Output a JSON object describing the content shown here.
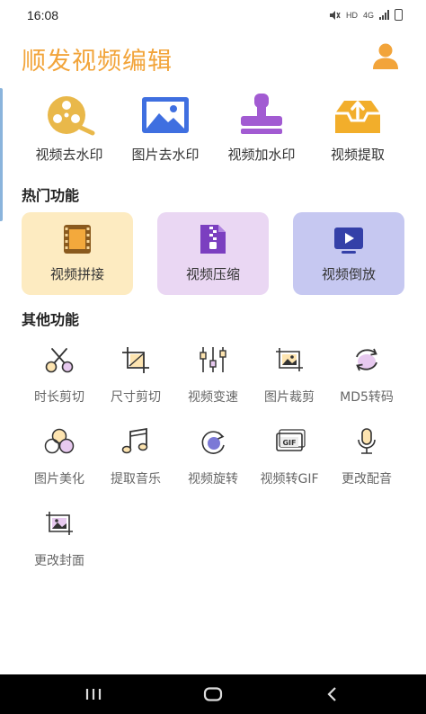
{
  "status_bar": {
    "time": "16:08",
    "hd": "HD",
    "network": "4G"
  },
  "header": {
    "title": "顺发视频编辑",
    "accent_color": "#f2a43a"
  },
  "top_features": [
    {
      "label": "视频去水印",
      "icon": "film-reel-icon"
    },
    {
      "label": "图片去水印",
      "icon": "landscape-image-icon"
    },
    {
      "label": "视频加水印",
      "icon": "stamp-icon"
    },
    {
      "label": "视频提取",
      "icon": "upload-tray-icon"
    }
  ],
  "hot_section": {
    "title": "热门功能",
    "cards": [
      {
        "label": "视频拼接",
        "icon": "film-strip-icon",
        "bg": "#fdebc1"
      },
      {
        "label": "视频压缩",
        "icon": "zip-file-icon",
        "bg": "#ead7f3"
      },
      {
        "label": "视频倒放",
        "icon": "play-icon",
        "bg": "#c6c8f1"
      }
    ]
  },
  "other_section": {
    "title": "其他功能",
    "tools": [
      {
        "label": "时长剪切",
        "icon": "scissors-icon"
      },
      {
        "label": "尺寸剪切",
        "icon": "crop-icon"
      },
      {
        "label": "视频变速",
        "icon": "sliders-icon"
      },
      {
        "label": "图片裁剪",
        "icon": "image-crop-icon"
      },
      {
        "label": "MD5转码",
        "icon": "refresh-icon"
      },
      {
        "label": "图片美化",
        "icon": "circles-icon"
      },
      {
        "label": "提取音乐",
        "icon": "music-note-icon"
      },
      {
        "label": "视频旋转",
        "icon": "rotate-icon"
      },
      {
        "label": "视频转GIF",
        "icon": "gif-icon"
      },
      {
        "label": "更改配音",
        "icon": "microphone-icon"
      },
      {
        "label": "更改封面",
        "icon": "cover-image-icon"
      }
    ]
  }
}
